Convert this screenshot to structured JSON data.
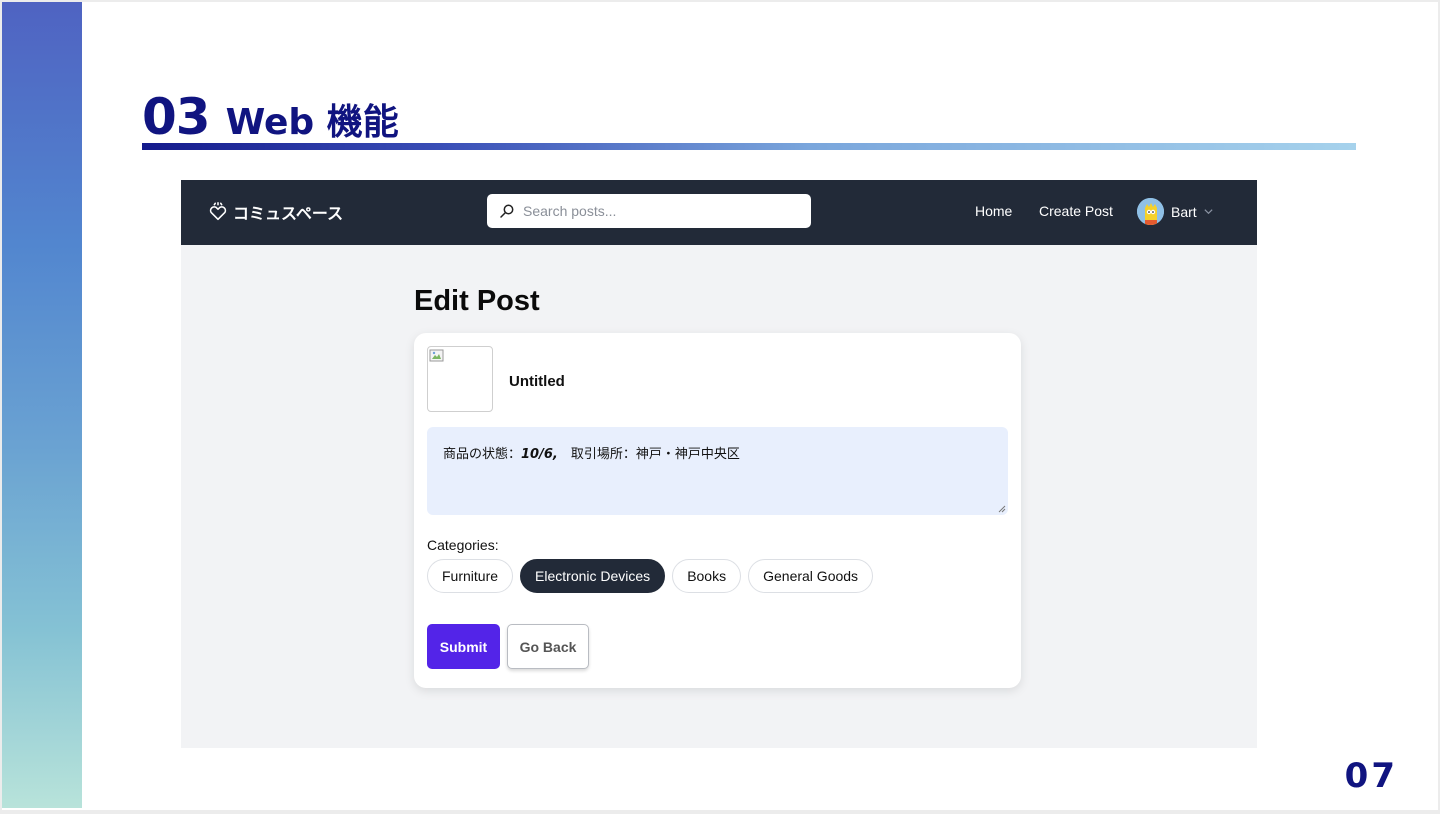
{
  "slide": {
    "section_number": "03",
    "section_title": "Web 機能",
    "page_number": "07",
    "colors": {
      "title": "#101480",
      "accent_purple": "#5324e8",
      "navbar": "#222a38"
    }
  },
  "app": {
    "brand": {
      "icon": "heart-hands-icon",
      "name": "コミュスペース"
    },
    "search": {
      "icon": "search-icon",
      "placeholder": "Search posts..."
    },
    "nav": {
      "home": "Home",
      "create_post": "Create Post"
    },
    "user": {
      "name": "Bart",
      "avatar_icon": "avatar-icon",
      "menu_icon": "chevron-down-icon"
    }
  },
  "edit_post": {
    "heading": "Edit Post",
    "image_icon": "broken-image-icon",
    "title": "Untitled",
    "description_prefix": "商品の状態：",
    "description_condition": "10/6,",
    "description_suffix": "　取引場所：神戸・神戸中央区",
    "categories_label": "Categories:",
    "categories": [
      {
        "label": "Furniture",
        "selected": false
      },
      {
        "label": "Electronic Devices",
        "selected": true
      },
      {
        "label": "Books",
        "selected": false
      },
      {
        "label": "General Goods",
        "selected": false
      }
    ],
    "submit_label": "Submit",
    "back_label": "Go Back"
  }
}
